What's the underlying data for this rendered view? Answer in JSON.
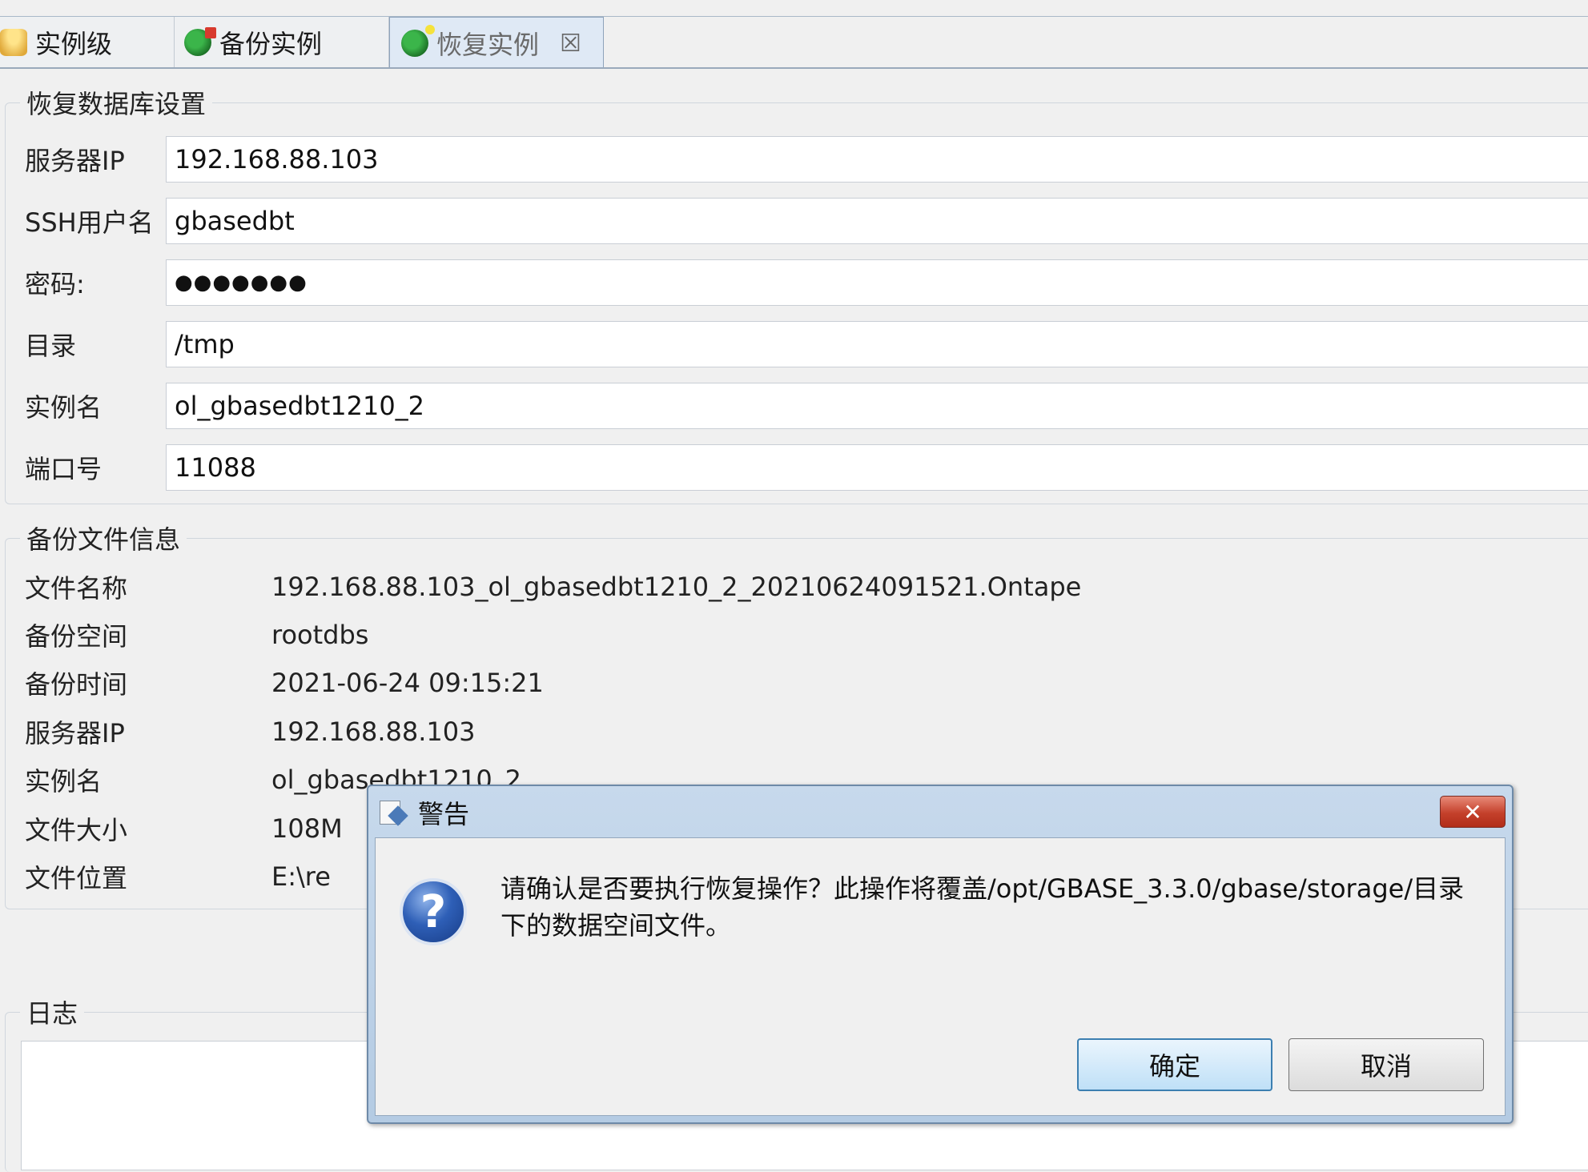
{
  "tabs": [
    {
      "label": "实例级",
      "icon": "db-gold-icon"
    },
    {
      "label": "备份实例",
      "icon": "db-backup-icon"
    },
    {
      "label": "恢复实例",
      "icon": "db-restore-icon",
      "close": "☒"
    }
  ],
  "restore_settings": {
    "legend": "恢复数据库设置",
    "fields": [
      {
        "label": "服务器IP",
        "value": "192.168.88.103"
      },
      {
        "label": "SSH用户名",
        "value": "gbasedbt"
      },
      {
        "label": "密码:",
        "value": "●●●●●●●"
      },
      {
        "label": "目录",
        "value": "/tmp"
      },
      {
        "label": "实例名",
        "value": "ol_gbasedbt1210_2"
      },
      {
        "label": "端口号",
        "value": "11088"
      }
    ]
  },
  "backup_info": {
    "legend": "备份文件信息",
    "rows": [
      {
        "label": "文件名称",
        "value": "192.168.88.103_ol_gbasedbt1210_2_20210624091521.Ontape"
      },
      {
        "label": "备份空间",
        "value": "rootdbs"
      },
      {
        "label": "备份时间",
        "value": "2021-06-24 09:15:21"
      },
      {
        "label": "服务器IP",
        "value": "192.168.88.103"
      },
      {
        "label": "实例名",
        "value": "ol_gbasedbt1210_2"
      },
      {
        "label": "文件大小",
        "value": "108M"
      },
      {
        "label": "文件位置",
        "value": "E:\\re"
      }
    ]
  },
  "log": {
    "legend": "日志"
  },
  "dialog": {
    "title": "警告",
    "close_label": "✕",
    "message": "请确认是否要执行恢复操作？此操作将覆盖/opt/GBASE_3.3.0/gbase/storage/目录下的数据空间文件。",
    "ok_label": "确定",
    "cancel_label": "取消"
  }
}
